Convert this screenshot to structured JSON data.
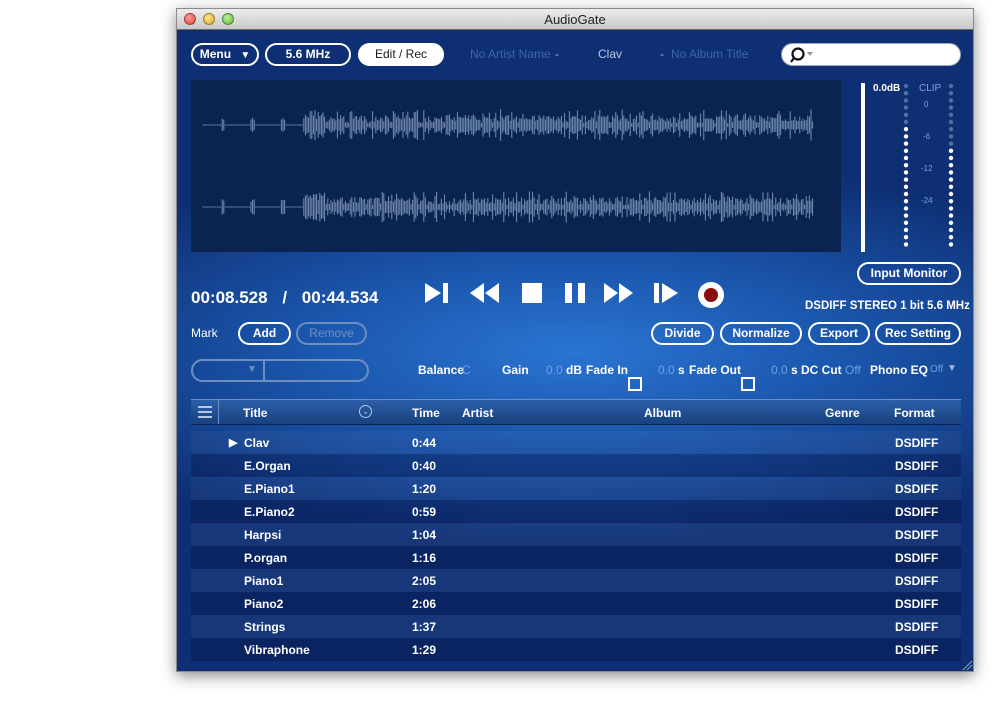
{
  "window": {
    "title": "AudioGate"
  },
  "toolbar": {
    "menu_label": "Menu",
    "rate_label": "5.6 MHz",
    "edit_label": "Edit / Rec",
    "artist": "No Artist Name",
    "sep1": "-",
    "track": "Clav",
    "sep2": "-",
    "album": "No Album Title"
  },
  "meter": {
    "level_label": "0.0dB",
    "clip_label": "CLIP",
    "scale": [
      "0",
      "-6",
      "-12",
      "-24"
    ]
  },
  "transport": {
    "current_time": "00:08.528",
    "separator": "/",
    "total_time": "00:44.534",
    "format_info": "DSDIFF STEREO 1 bit 5.6 MHz",
    "input_monitor_label": "Input Monitor"
  },
  "mark": {
    "label": "Mark",
    "add_label": "Add",
    "remove_label": "Remove"
  },
  "actions": {
    "divide": "Divide",
    "normalize": "Normalize",
    "export": "Export",
    "rec_setting": "Rec Setting"
  },
  "params": {
    "balance_label": "Balance",
    "balance_value": "C",
    "gain_label": "Gain",
    "gain_value": "0.0",
    "gain_unit": "dB",
    "fade_in_label": "Fade In",
    "fade_in_value": "0.0",
    "fade_in_unit": "s",
    "fade_out_label": "Fade Out",
    "fade_out_value": "0.0",
    "fade_out_unit": "s",
    "dc_cut_label": "DC Cut",
    "dc_cut_value": "Off",
    "phono_eq_label": "Phono EQ",
    "phono_eq_value": "Off"
  },
  "table": {
    "headers": {
      "title": "Title",
      "time": "Time",
      "artist": "Artist",
      "album": "Album",
      "genre": "Genre",
      "format": "Format"
    },
    "rows": [
      {
        "title": "Clav",
        "time": "0:44",
        "format": "DSDIFF",
        "playing": true
      },
      {
        "title": "E.Organ",
        "time": "0:40",
        "format": "DSDIFF"
      },
      {
        "title": "E.Piano1",
        "time": "1:20",
        "format": "DSDIFF"
      },
      {
        "title": "E.Piano2",
        "time": "0:59",
        "format": "DSDIFF"
      },
      {
        "title": "Harpsi",
        "time": "1:04",
        "format": "DSDIFF"
      },
      {
        "title": "P.organ",
        "time": "1:16",
        "format": "DSDIFF"
      },
      {
        "title": "Piano1",
        "time": "2:05",
        "format": "DSDIFF"
      },
      {
        "title": "Piano2",
        "time": "2:06",
        "format": "DSDIFF"
      },
      {
        "title": "Strings",
        "time": "1:37",
        "format": "DSDIFF"
      },
      {
        "title": "Vibraphone",
        "time": "1:29",
        "format": "DSDIFF"
      }
    ]
  }
}
